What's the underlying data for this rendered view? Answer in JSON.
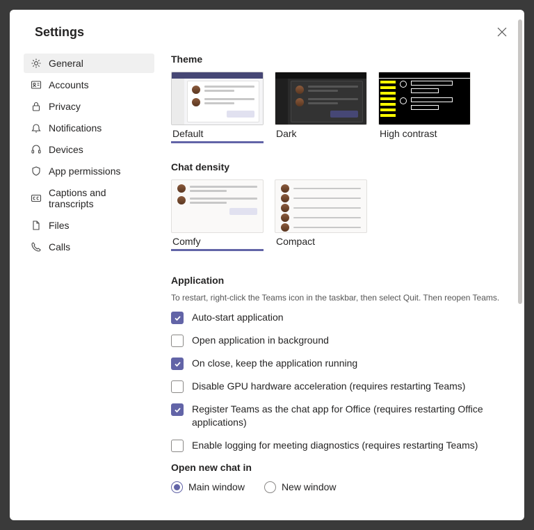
{
  "title": "Settings",
  "sidebar": {
    "items": [
      {
        "label": "General",
        "active": true
      },
      {
        "label": "Accounts"
      },
      {
        "label": "Privacy"
      },
      {
        "label": "Notifications"
      },
      {
        "label": "Devices"
      },
      {
        "label": "App permissions"
      },
      {
        "label": "Captions and transcripts"
      },
      {
        "label": "Files"
      },
      {
        "label": "Calls"
      }
    ]
  },
  "theme": {
    "title": "Theme",
    "options": [
      {
        "label": "Default",
        "selected": true
      },
      {
        "label": "Dark"
      },
      {
        "label": "High contrast"
      }
    ]
  },
  "density": {
    "title": "Chat density",
    "options": [
      {
        "label": "Comfy",
        "selected": true
      },
      {
        "label": "Compact"
      }
    ]
  },
  "application": {
    "title": "Application",
    "subtitle": "To restart, right-click the Teams icon in the taskbar, then select Quit. Then reopen Teams.",
    "items": [
      {
        "label": "Auto-start application",
        "checked": true
      },
      {
        "label": "Open application in background",
        "checked": false
      },
      {
        "label": "On close, keep the application running",
        "checked": true
      },
      {
        "label": "Disable GPU hardware acceleration (requires restarting Teams)",
        "checked": false
      },
      {
        "label": "Register Teams as the chat app for Office (requires restarting Office applications)",
        "checked": true
      },
      {
        "label": "Enable logging for meeting diagnostics (requires restarting Teams)",
        "checked": false
      }
    ]
  },
  "open_chat": {
    "title": "Open new chat in",
    "options": [
      {
        "label": "Main window",
        "checked": true
      },
      {
        "label": "New window",
        "checked": false
      }
    ]
  }
}
